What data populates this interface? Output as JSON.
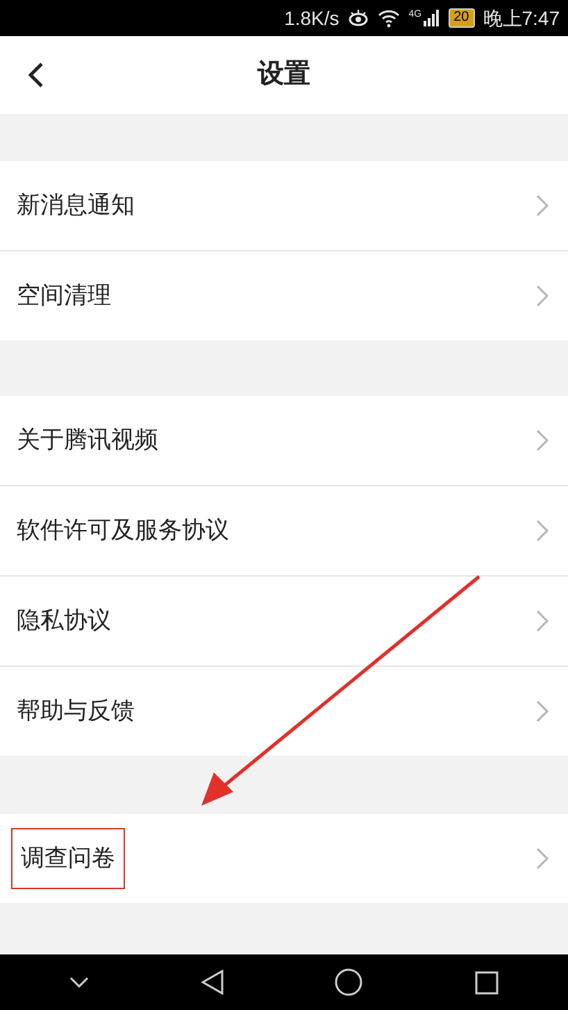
{
  "status_bar": {
    "speed": "1.8K/s",
    "network": "4G",
    "battery": "20",
    "time": "晚上7:47"
  },
  "header": {
    "title": "设置"
  },
  "groups": [
    {
      "items": [
        {
          "label": "新消息通知",
          "highlighted": false
        },
        {
          "label": "空间清理",
          "highlighted": false
        }
      ]
    },
    {
      "items": [
        {
          "label": "关于腾讯视频",
          "highlighted": false
        },
        {
          "label": "软件许可及服务协议",
          "highlighted": false
        },
        {
          "label": "隐私协议",
          "highlighted": false
        },
        {
          "label": "帮助与反馈",
          "highlighted": false
        }
      ]
    },
    {
      "items": [
        {
          "label": "调查问卷",
          "highlighted": true
        }
      ]
    }
  ]
}
